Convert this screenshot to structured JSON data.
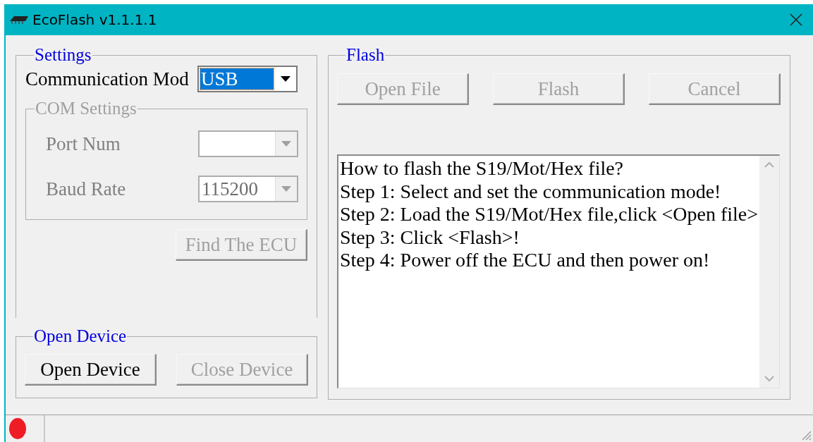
{
  "window": {
    "title": "EcoFlash v1.1.1.1"
  },
  "settings": {
    "legend": "Settings",
    "mode_label": "Communication Mod",
    "mode_value": "USB",
    "mode_disabled": false,
    "com_settings": {
      "legend": "COM Settings",
      "disabled": true,
      "fields": [
        {
          "label": "Port Num"
        },
        {
          "label": "Baud Rate",
          "value": "115200"
        }
      ]
    },
    "find_button": {
      "label": "Find The ECU",
      "disabled": true
    }
  },
  "open_device": {
    "legend": "Open Device",
    "buttons": [
      {
        "label": "Open Device",
        "disabled": false
      },
      {
        "label": "Close Device",
        "disabled": true
      }
    ]
  },
  "flash": {
    "legend": "Flash",
    "buttons": [
      {
        "label": "Open File",
        "disabled": true
      },
      {
        "label": "Flash",
        "disabled": true
      },
      {
        "label": "Cancel",
        "disabled": true
      }
    ],
    "log_lines": [
      "How to flash the S19/Mot/Hex file?",
      "Step 1: Select and set the communication mode!",
      "Step 2: Load the S19/Mot/Hex file,click <Open file>",
      "Step 3: Click <Flash>!",
      "Step 4: Power off the ECU and then power on!"
    ]
  }
}
